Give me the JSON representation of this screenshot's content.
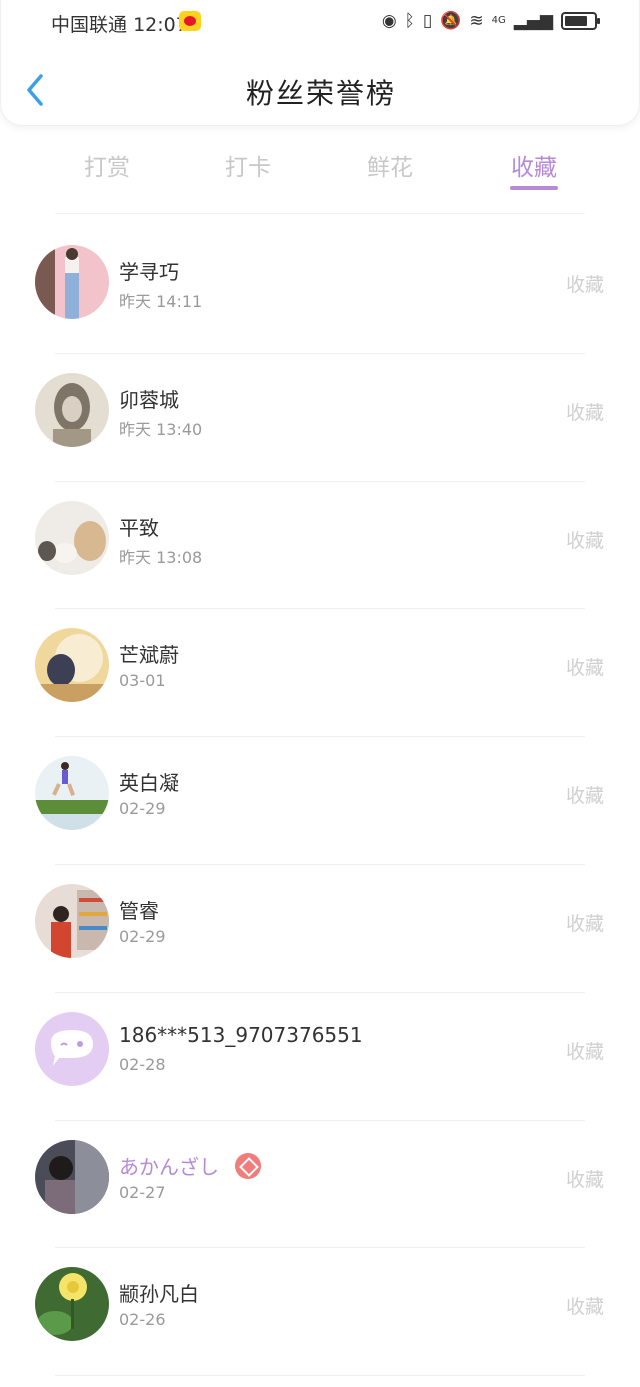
{
  "status_bar": {
    "carrier": "中国联通",
    "time": "12:07",
    "network": "4G"
  },
  "header": {
    "title": "粉丝荣誉榜"
  },
  "tabs": [
    {
      "label": "打赏",
      "active": false
    },
    {
      "label": "打卡",
      "active": false
    },
    {
      "label": "鲜花",
      "active": false
    },
    {
      "label": "收藏",
      "active": true
    }
  ],
  "colors": {
    "accent": "#b68ad9",
    "back_icon": "#3aa0e8",
    "vip_badge": "#f27c7c"
  },
  "fans": [
    {
      "name": "学寻巧",
      "time": "昨天 14:11",
      "action": "收藏"
    },
    {
      "name": "卯蓉城",
      "time": "昨天 13:40",
      "action": "收藏"
    },
    {
      "name": "平致",
      "time": "昨天 13:08",
      "action": "收藏"
    },
    {
      "name": "芒斌蔚",
      "time": "03-01",
      "action": "收藏"
    },
    {
      "name": "英白凝",
      "time": "02-29",
      "action": "收藏"
    },
    {
      "name": "管睿",
      "time": "02-29",
      "action": "收藏"
    },
    {
      "name": "186***513_9707376551",
      "time": "02-28",
      "action": "收藏"
    },
    {
      "name": "あかんざし",
      "time": "02-27",
      "action": "收藏",
      "vip": true
    },
    {
      "name": "颛孙凡白",
      "time": "02-26",
      "action": "收藏"
    }
  ]
}
